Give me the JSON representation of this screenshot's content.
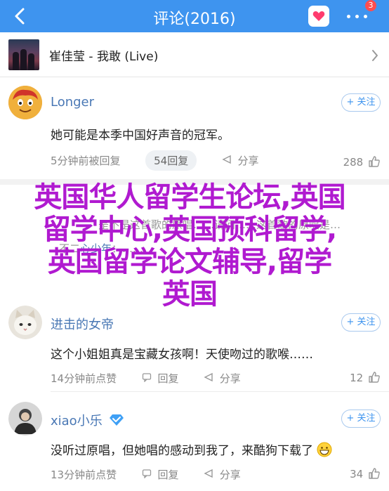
{
  "header": {
    "title": "评论(2016)",
    "badge": "3",
    "accent": "#3e94ef"
  },
  "song": {
    "title": "崔佳莹 - 我敢 (Live)"
  },
  "comments": [
    {
      "username": "Longer",
      "follow_label": "+ 关注",
      "text": "她可能是本季中国好声音的冠军。",
      "time": "5分钟前被回复",
      "replies": "54回复",
      "share": "分享",
      "likes": "288"
    },
    {
      "username": "进击的女帝",
      "follow_label": "+ 关注",
      "text": "这个小姐姐真是宝藏女孩啊！天使吻过的歌喉……",
      "time": "14分钟前点赞",
      "reply": "回复",
      "share": "分享",
      "likes": "12"
    },
    {
      "username": "xiao小乐",
      "follow_label": "+ 关注",
      "text": "没听过原唱，但她唱的感动到我了，来酷狗下载了",
      "time": "13分钟前点赞",
      "reply": "回复",
      "share": "分享",
      "likes": "34"
    }
  ],
  "ghost": {
    "line1": "是不是这首歌的原唱……请问……这首歌的原唱是…",
    "line2_prefix": "不二",
    "line2_link": "心少年",
    "line2_rest": "：……"
  },
  "overlay": {
    "row1": "英国华人留学生论坛,英国",
    "row2": "留学中心,英国预科留学,",
    "row3": "英国留学论文辅导,留学",
    "row4": "英国"
  }
}
